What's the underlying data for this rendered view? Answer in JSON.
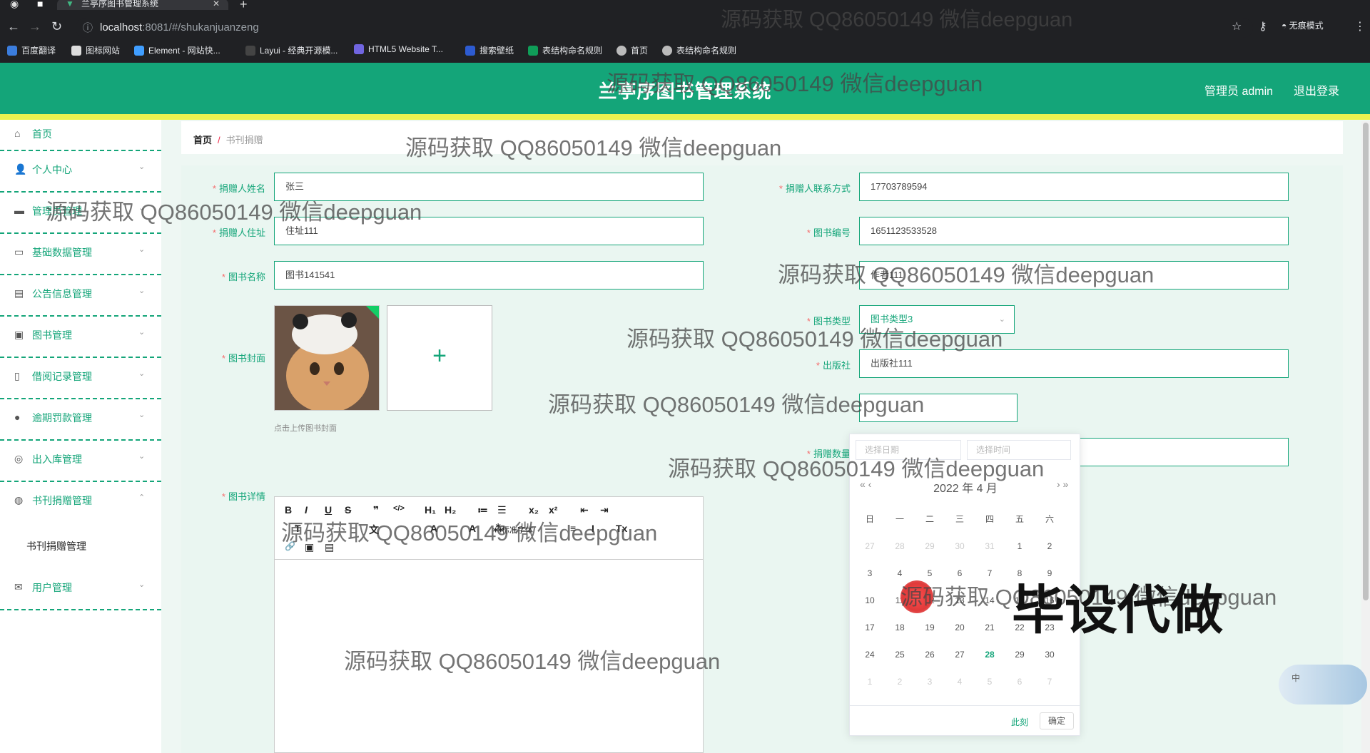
{
  "browser": {
    "tab_title": "兰亭序图书管理系统",
    "tab_close": "✕",
    "url_host": "localhost",
    "url_path": ":8081/#/shukanjuanzeng",
    "incognito_label": "无痕模式",
    "bookmarks": [
      "百度翻译",
      "图标网站",
      "Element - 网站快...",
      "Layui - 经典开源模...",
      "HTML5 Website T...",
      "搜索壁纸",
      "表结构命名规则",
      "首页",
      "表结构命名规则"
    ]
  },
  "header": {
    "title": "兰亭序图书管理系统",
    "admin": "管理员 admin",
    "logout": "退出登录"
  },
  "sidebar": {
    "items": [
      {
        "label": "首页",
        "icon": "home-icon"
      },
      {
        "label": "个人中心",
        "icon": "user-icon"
      },
      {
        "label": "管理员管理",
        "icon": "monitor-icon"
      },
      {
        "label": "基础数据管理",
        "icon": "chat-icon"
      },
      {
        "label": "公告信息管理",
        "icon": "clipboard-icon"
      },
      {
        "label": "图书管理",
        "icon": "message-icon"
      },
      {
        "label": "借阅记录管理",
        "icon": "phone-icon"
      },
      {
        "label": "逾期罚款管理",
        "icon": "location-icon"
      },
      {
        "label": "出入库管理",
        "icon": "globe-icon"
      },
      {
        "label": "书刊捐赠管理",
        "icon": "compass-icon"
      },
      {
        "label": "用户管理",
        "icon": "mail-icon"
      }
    ],
    "sub_item": "书刊捐赠管理"
  },
  "breadcrumb": {
    "home": "首页",
    "sep": "/",
    "current": "书刊捐赠"
  },
  "form": {
    "donor_name_label": "捐赠人姓名",
    "donor_name": "张三",
    "donor_phone_label": "捐赠人联系方式",
    "donor_phone": "17703789594",
    "donor_addr_label": "捐赠人住址",
    "donor_addr": "住址111",
    "book_no_label": "图书编号",
    "book_no": "1651123533528",
    "book_name_label": "图书名称",
    "book_name": "图书141541",
    "author_value": "作者111",
    "book_type_label": "图书类型",
    "book_type": "图书类型3",
    "publisher_label": "出版社",
    "publisher": "出版社111",
    "cover_label": "图书封面",
    "cover_tip": "点击上传图书封面",
    "donate_qty_label": "捐赠数量",
    "detail_label": "图书详情",
    "required_mark": "*",
    "upload_plus": "+"
  },
  "editor_toolbar": {
    "row1": [
      "B",
      "I",
      "U",
      "S",
      "❞",
      "</>",
      "H₁",
      "H₂",
      "≔",
      "☰",
      "x₂",
      "x²",
      "⇤",
      "⇥"
    ],
    "row2": [
      "T",
      "文",
      "A",
      "A",
      "⁂",
      "标准字体",
      "≡",
      "I",
      "Tx"
    ],
    "row3": [
      "🔗",
      "▣",
      "▤"
    ]
  },
  "datepicker": {
    "date_placeholder": "选择日期",
    "time_placeholder": "选择时间",
    "header": "2022 年  4 月",
    "nav_prev": "« ‹",
    "nav_next": "› »",
    "weekdays": [
      "日",
      "一",
      "二",
      "三",
      "四",
      "五",
      "六"
    ],
    "weeks": [
      [
        "27",
        "28",
        "29",
        "30",
        "31",
        "1",
        "2"
      ],
      [
        "3",
        "4",
        "5",
        "6",
        "7",
        "8",
        "9"
      ],
      [
        "10",
        "11",
        "12",
        "13",
        "14",
        "15",
        "16"
      ],
      [
        "17",
        "18",
        "19",
        "20",
        "21",
        "22",
        "23"
      ],
      [
        "24",
        "25",
        "26",
        "27",
        "28",
        "29",
        "30"
      ],
      [
        "1",
        "2",
        "3",
        "4",
        "5",
        "6",
        "7"
      ]
    ],
    "today": "28",
    "now_label": "此刻",
    "confirm_label": "确定"
  },
  "float_btn": "中",
  "watermark": "源码获取 QQ86050149 微信deepguan",
  "watermark_big": "毕设代做",
  "colors": {
    "accent": "#14a579",
    "header_stripe": "#ecf150",
    "required": "#f56c6c"
  }
}
